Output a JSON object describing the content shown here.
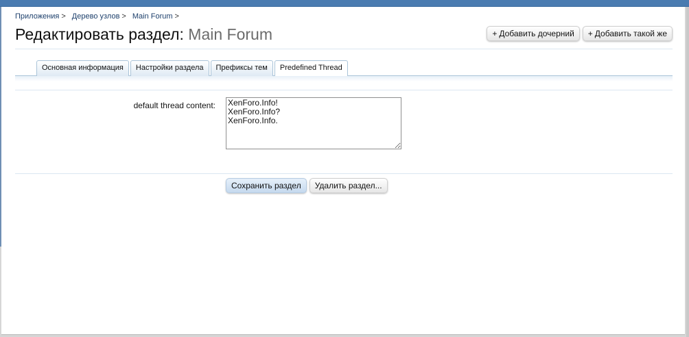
{
  "breadcrumb": [
    {
      "label": "Приложения"
    },
    {
      "label": "Дерево узлов"
    },
    {
      "label": "Main Forum"
    }
  ],
  "breadcrumb_separator": ">",
  "page": {
    "title_prefix": "Редактировать раздел:",
    "title_node": "Main Forum"
  },
  "actions": {
    "plus_glyph": "+",
    "add_child_label": "Добавить дочерний",
    "add_sibling_label": "Добавить такой же"
  },
  "tabs": [
    {
      "label": "Основная информация",
      "active": false
    },
    {
      "label": "Настройки раздела",
      "active": false
    },
    {
      "label": "Префиксы тем",
      "active": false
    },
    {
      "label": "Predefined Thread",
      "active": true
    }
  ],
  "form": {
    "field_label": "default thread content:",
    "field_value": "XenForo.Info!\nXenForo.Info?\nXenForo.Info.",
    "save_label": "Сохранить раздел",
    "delete_label": "Удалить раздел..."
  },
  "colors": {
    "topbar": "#4a7bb0",
    "link": "#1c3f6b",
    "tab_border": "#a9c3d8",
    "primary_button": "#c5d9ee"
  }
}
